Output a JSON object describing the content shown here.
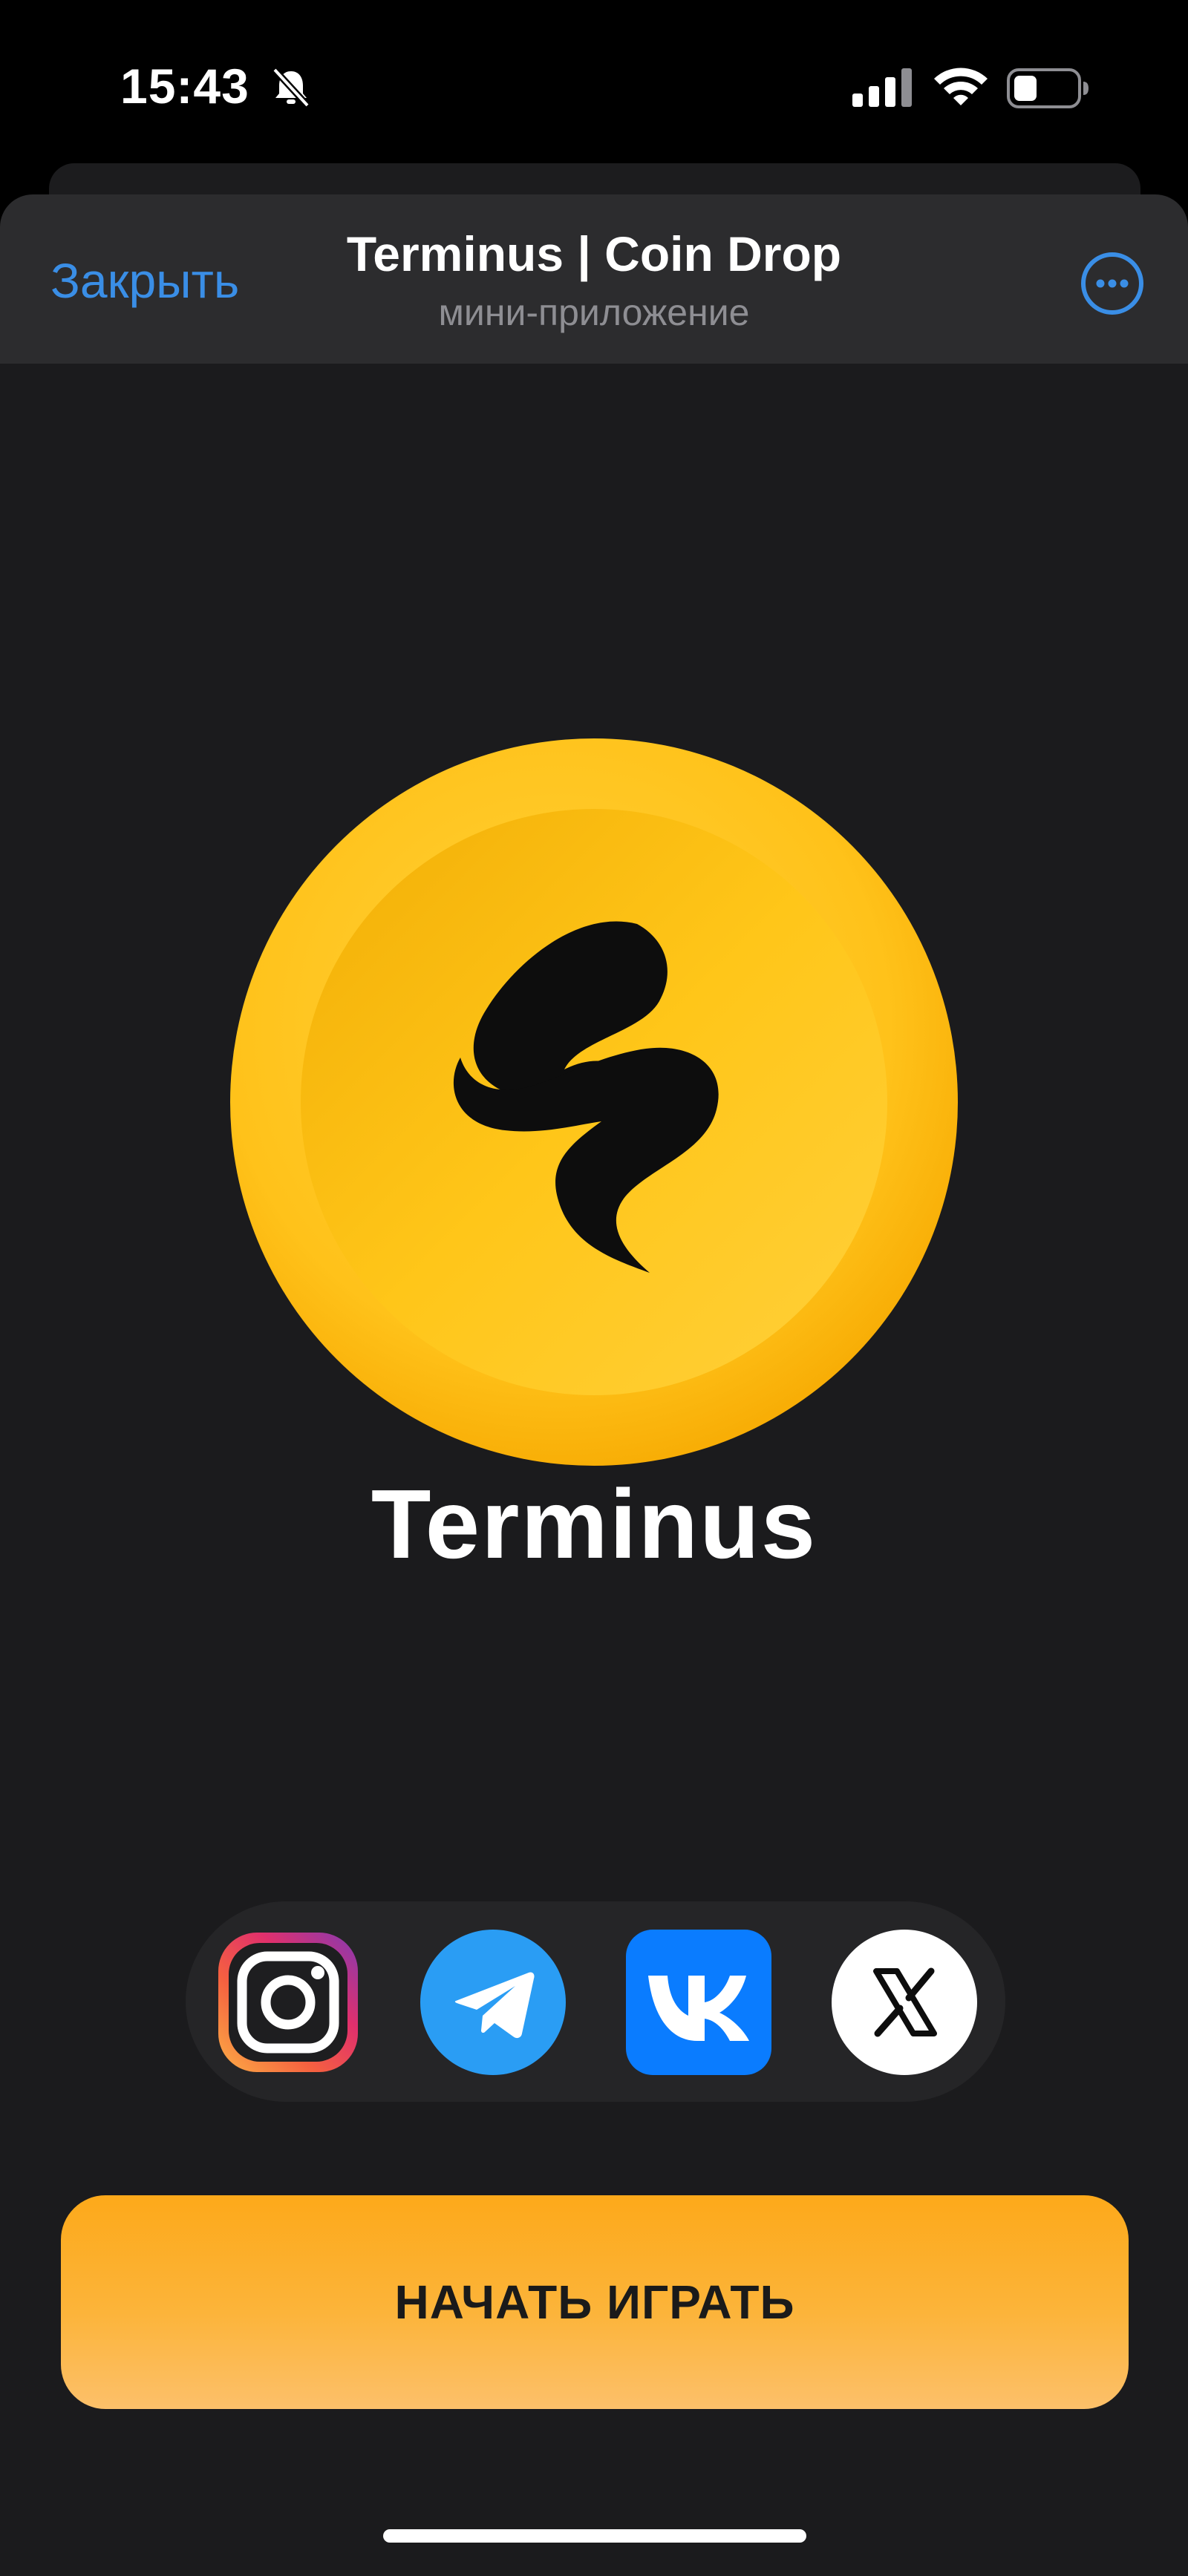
{
  "status_bar": {
    "time": "15:43",
    "icons": [
      "bell-off-icon",
      "signal-icon",
      "wifi-icon",
      "battery-icon"
    ]
  },
  "header": {
    "close_label": "Закрыть",
    "title": "Terminus | Coin Drop",
    "subtitle": "мини-приложение",
    "more_icon": "ellipsis-circle-icon"
  },
  "main": {
    "logo_icon": "terminus-coin-logo",
    "brand_name": "Terminus",
    "socials": [
      {
        "name": "instagram",
        "icon": "instagram-icon"
      },
      {
        "name": "telegram",
        "icon": "telegram-icon"
      },
      {
        "name": "vk",
        "icon": "vk-icon",
        "letters": "VK"
      },
      {
        "name": "x",
        "icon": "x-icon",
        "letter": "X"
      }
    ],
    "start_label": "НАЧАТЬ ИГРАТЬ"
  },
  "colors": {
    "accent_link": "#3a8ee6",
    "coin_yellow": "#ffc21a",
    "button_orange": "#fda91a",
    "background": "#1b1b1d",
    "header_bg": "#2c2c2e",
    "vk_blue": "#0a7cff",
    "telegram_blue": "#2a9df4"
  }
}
